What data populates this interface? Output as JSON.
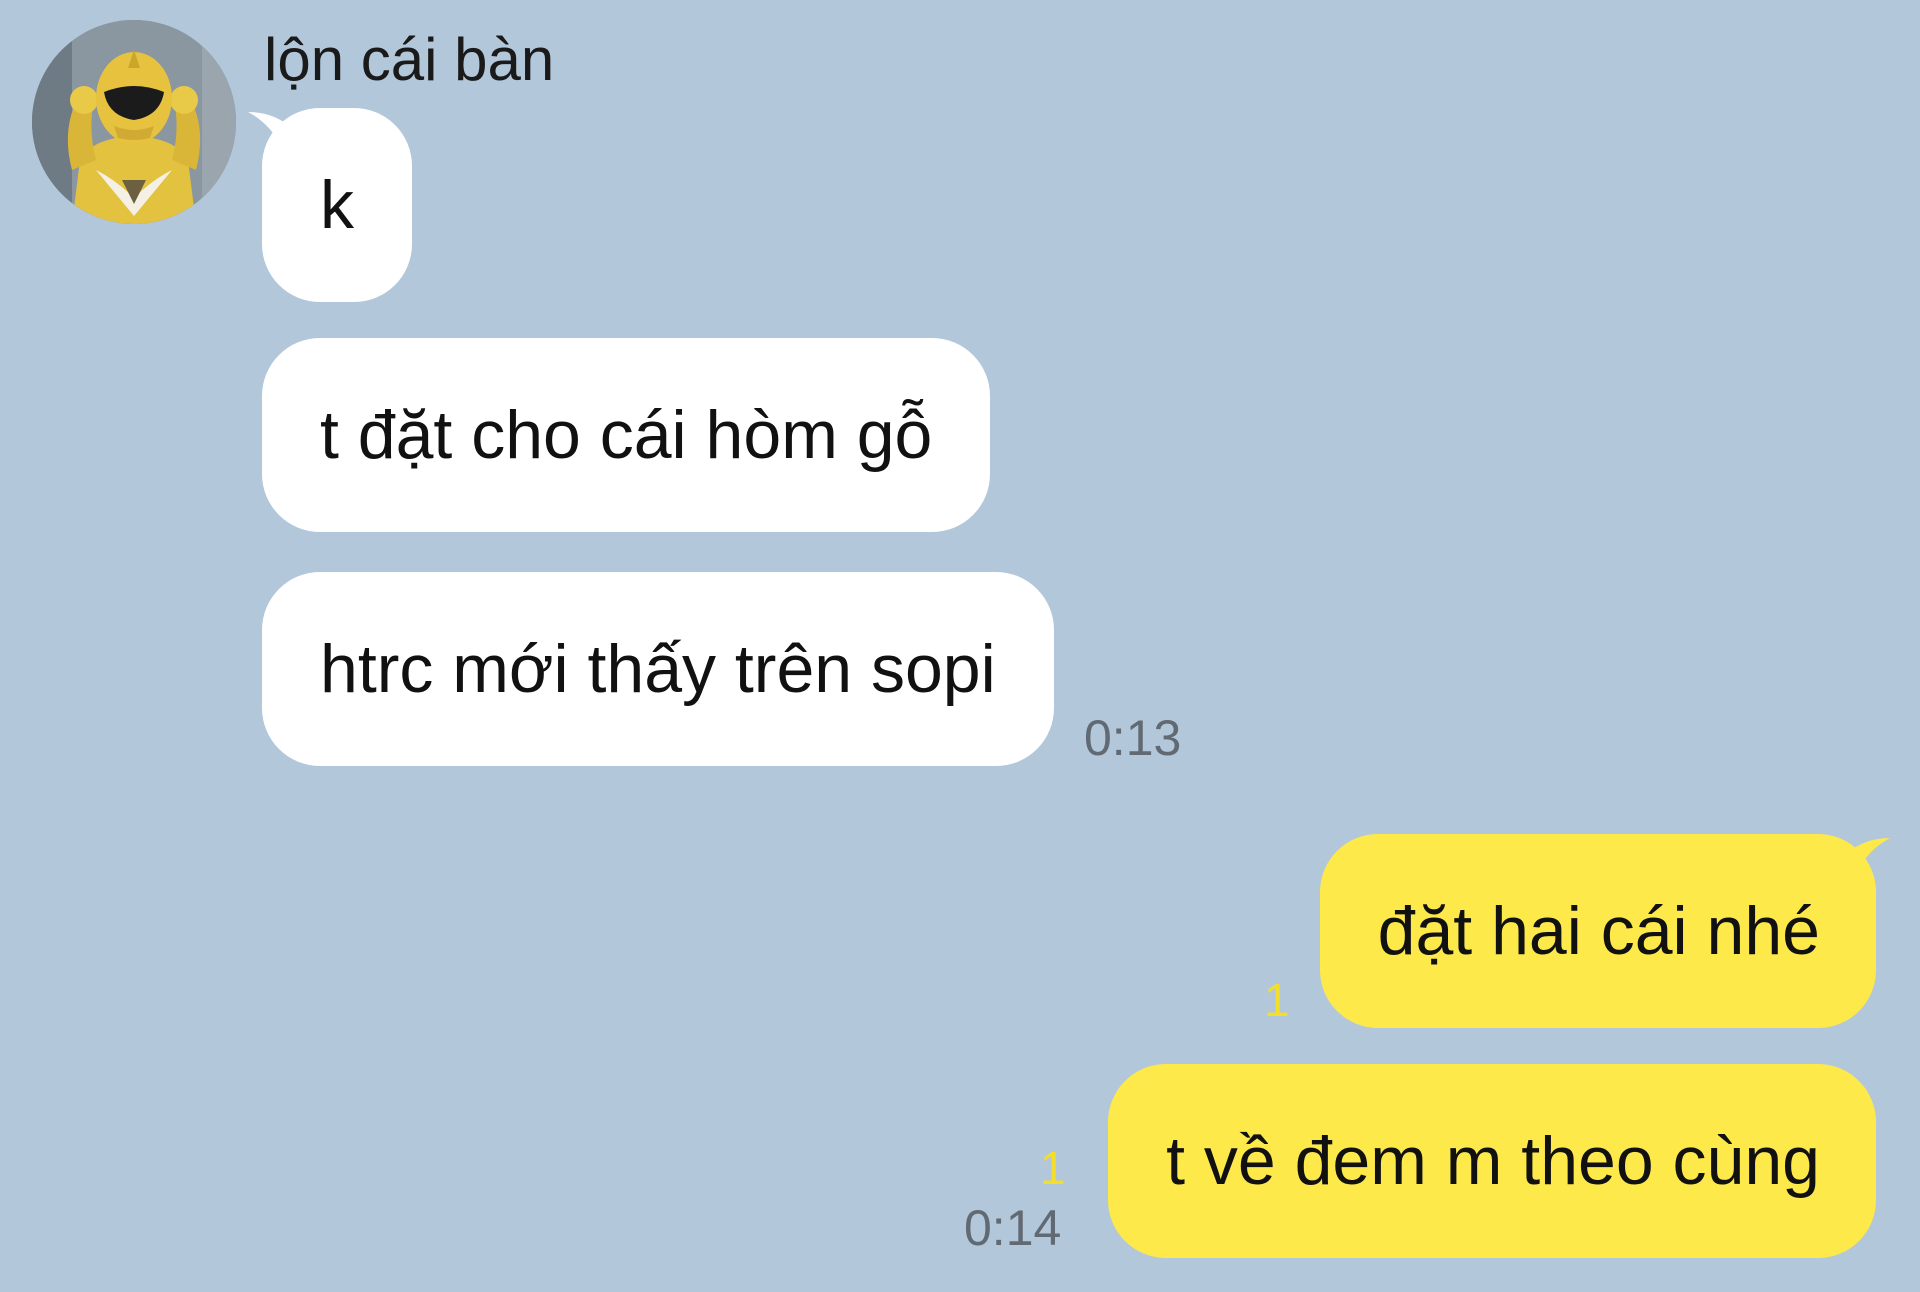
{
  "chat": {
    "sender": {
      "name": "lộn cái bàn",
      "avatar_icon": "yellow-ranger-avatar"
    },
    "incoming_messages": [
      {
        "text": "k"
      },
      {
        "text": "t đặt cho cái hòm gỗ"
      },
      {
        "text": "htrc mới thấy trên sopi"
      }
    ],
    "incoming_time": "0:13",
    "outgoing_messages": [
      {
        "text": "đặt hai cái nhé",
        "unread": "1"
      },
      {
        "text": "t về đem m theo cùng",
        "unread": "1"
      }
    ],
    "outgoing_time": "0:14",
    "colors": {
      "background": "#b2c7da",
      "incoming_bubble": "#ffffff",
      "outgoing_bubble": "#fee94a",
      "unread_count": "#f3de2c",
      "timestamp": "#616a73"
    }
  }
}
